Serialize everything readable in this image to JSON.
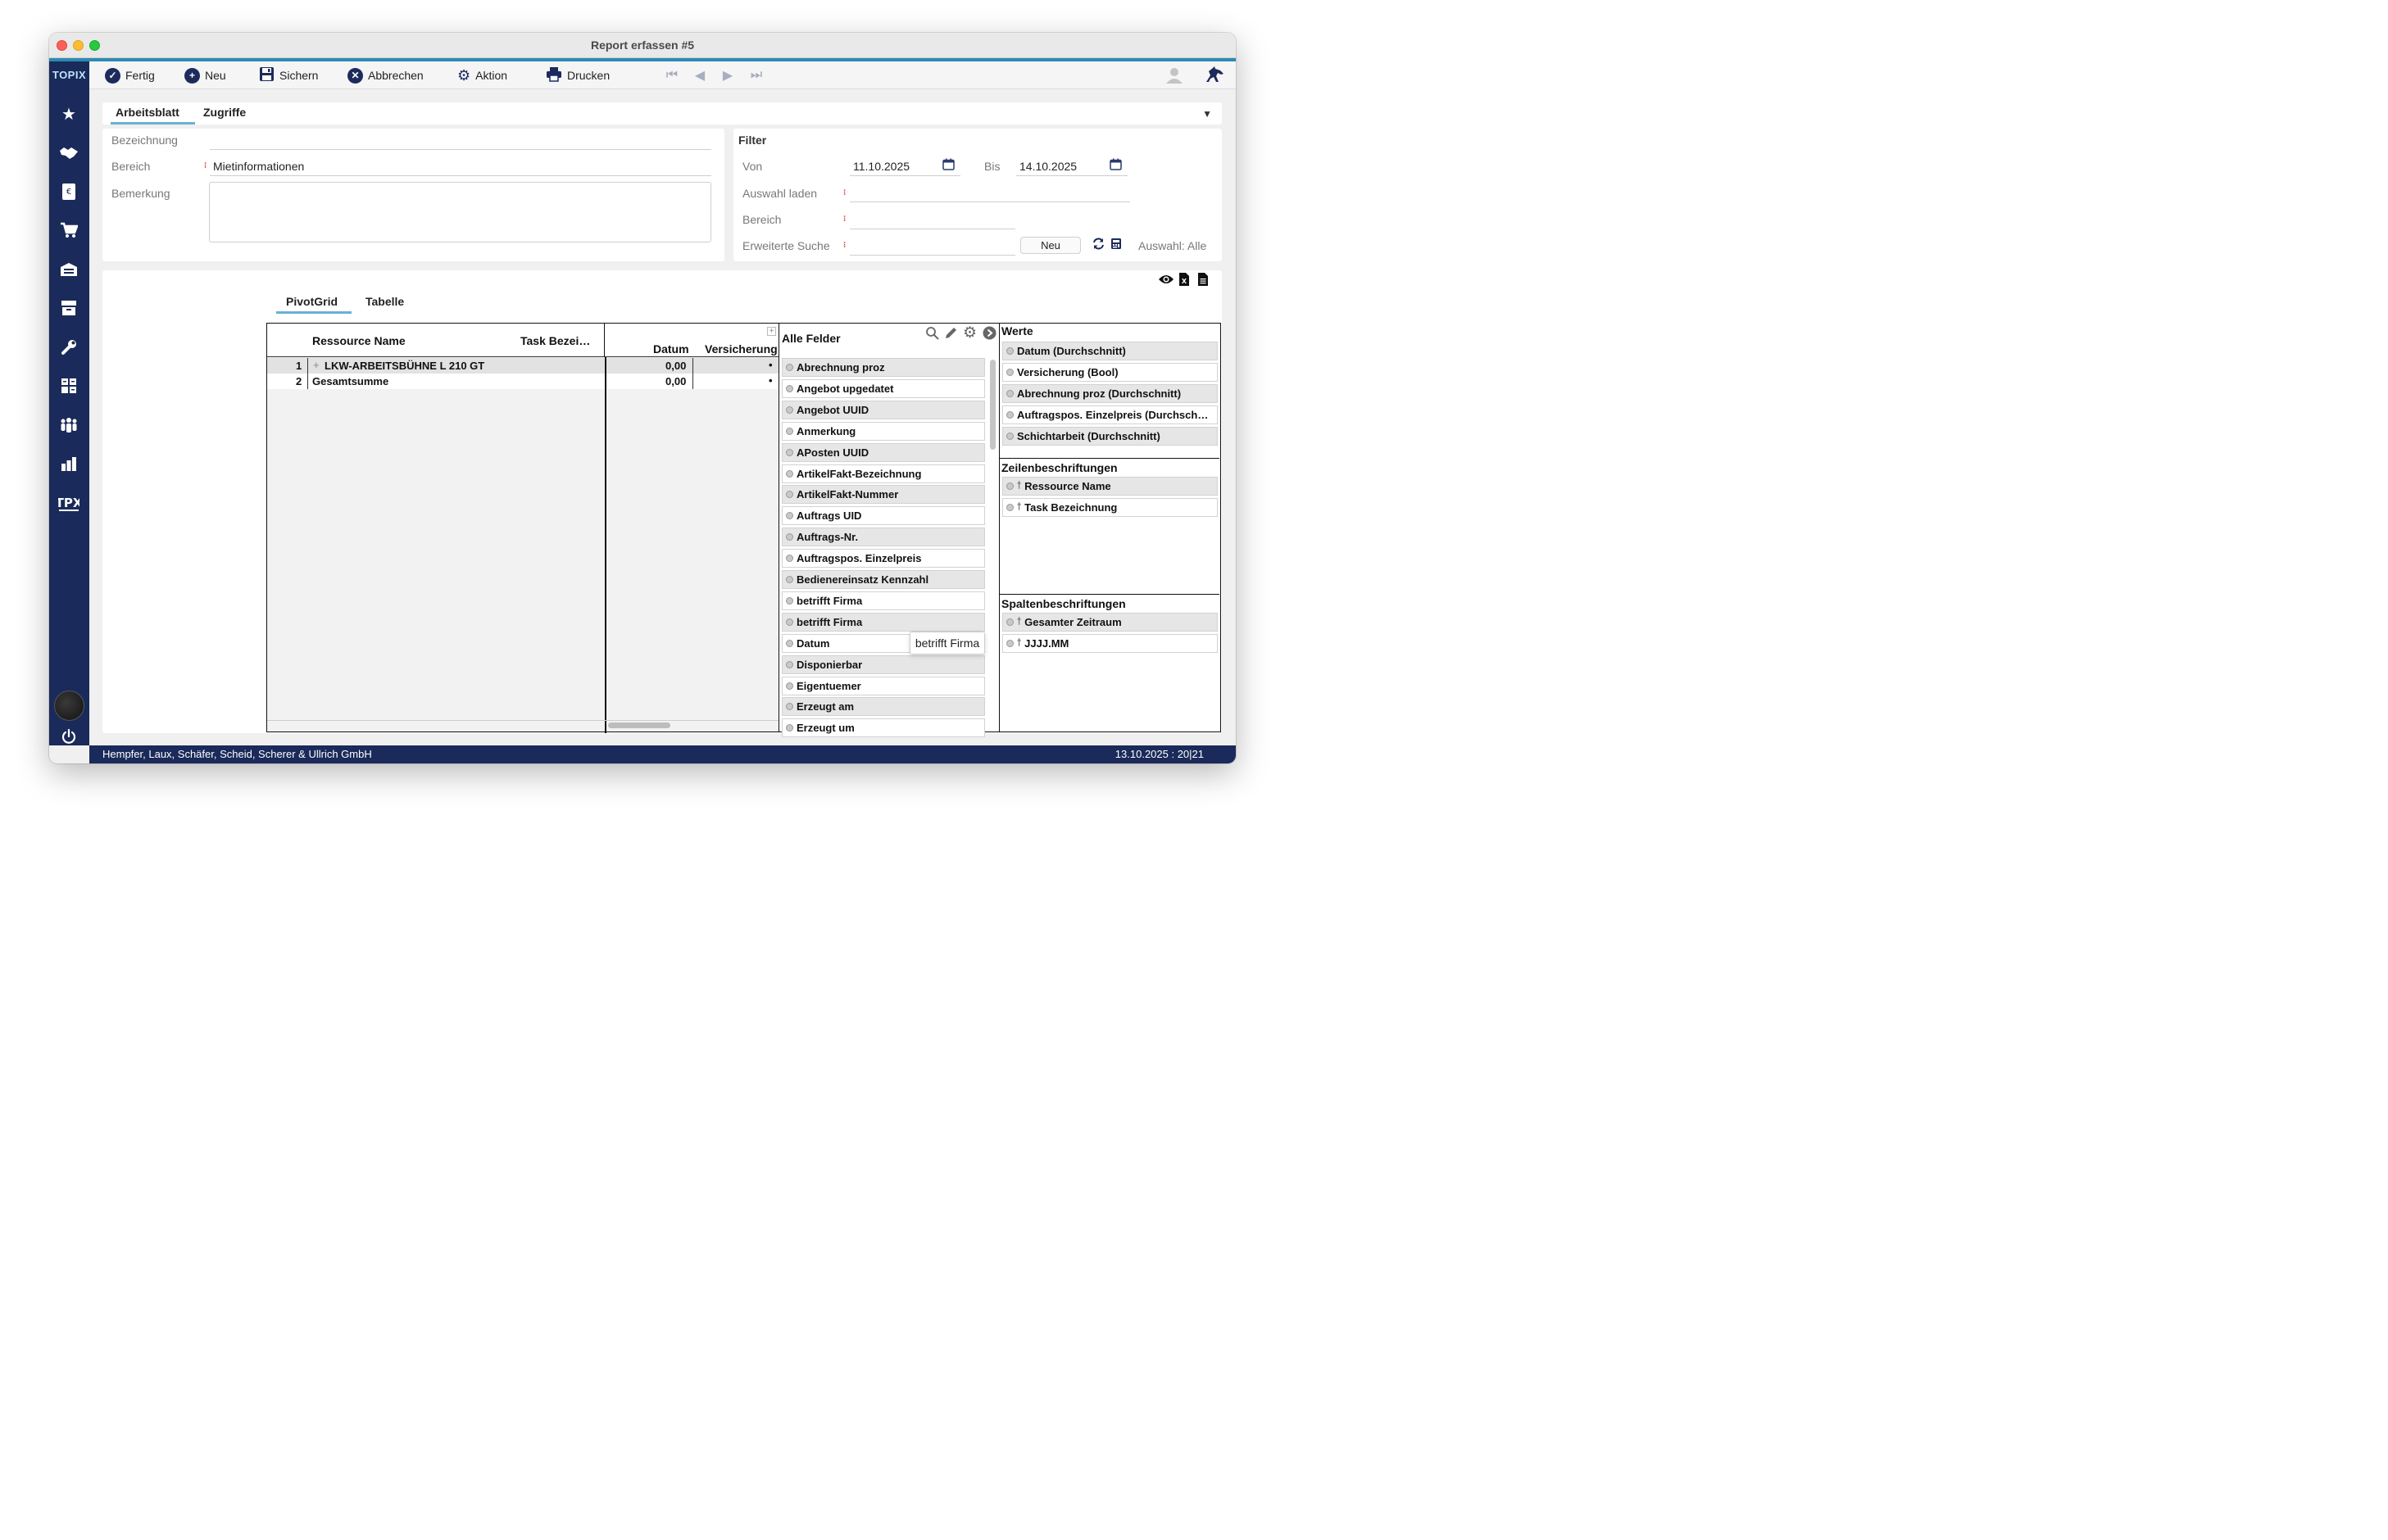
{
  "window": {
    "title": "Report erfassen #5"
  },
  "sidebar": {
    "logo": "TOPIX",
    "icons": [
      "star-icon",
      "handshake-icon",
      "invoice-icon",
      "cart-icon",
      "warehouse-icon",
      "archive-icon",
      "wrench-icon",
      "calculator-icon",
      "people-icon",
      "bar-chart-icon",
      "tpx-icon"
    ],
    "bottom_icon": "power-icon"
  },
  "toolbar": {
    "fertig": "Fertig",
    "neu": "Neu",
    "sichern": "Sichern",
    "abbrechen": "Abbrechen",
    "aktion": "Aktion",
    "drucken": "Drucken"
  },
  "tabs": {
    "arbeitsblatt": "Arbeitsblatt",
    "zugriffe": "Zugriffe"
  },
  "form": {
    "bezeichnung_label": "Bezeichnung",
    "bezeichnung_value": "",
    "bereich_label": "Bereich",
    "bereich_value": "Mietinformationen",
    "bemerkung_label": "Bemerkung",
    "bemerkung_value": ""
  },
  "filter": {
    "title": "Filter",
    "von_label": "Von",
    "von_value": "11.10.2025",
    "bis_label": "Bis",
    "bis_value": "14.10.2025",
    "auswahl_laden_label": "Auswahl laden",
    "bereich_label": "Bereich",
    "erweiterte_suche_label": "Erweiterte Suche",
    "neu_button": "Neu",
    "auswahl_text": "Auswahl: Alle"
  },
  "pivot_tabs": {
    "pivotgrid": "PivotGrid",
    "tabelle": "Tabelle"
  },
  "grid": {
    "col_ressource": "Ressource Name",
    "col_task": "Task Bezei…",
    "col_datum": "Datum",
    "col_versicherung": "Versicherung",
    "rows": [
      {
        "num": "1",
        "expand": "+",
        "name": "LKW-ARBEITSBÜHNE L 210 GT",
        "datum": "0,00",
        "versicherung": "•"
      },
      {
        "num": "2",
        "expand": "",
        "name": "Gesamtsumme",
        "datum": "0,00",
        "versicherung": "•"
      }
    ]
  },
  "fields": {
    "title": "Alle Felder",
    "items": [
      "Abrechnung proz",
      "Angebot upgedatet",
      "Angebot UUID",
      "Anmerkung",
      "APosten UUID",
      "ArtikelFakt-Bezeichnung",
      "ArtikelFakt-Nummer",
      "Auftrags UID",
      "Auftrags-Nr.",
      "Auftragspos. Einzelpreis",
      "Bedienereinsatz Kennzahl",
      "betrifft Firma",
      "betrifft Firma",
      "Datum",
      "Disponierbar",
      "Eigentuemer",
      "Erzeugt am",
      "Erzeugt um"
    ],
    "tooltip": "betrifft Firma"
  },
  "areas": {
    "werte_title": "Werte",
    "werte": [
      "Datum (Durchschnitt)",
      "Versicherung (Bool)",
      "Abrechnung proz (Durchschnitt)",
      "Auftragspos. Einzelpreis (Durchsch…",
      "Schichtarbeit (Durchschnitt)"
    ],
    "zeilen_title": "Zeilenbeschriftungen",
    "zeilen": [
      "Ressource Name",
      "Task Bezeichnung"
    ],
    "spalten_title": "Spaltenbeschriftungen",
    "spalten": [
      "Gesamter Zeitraum",
      "JJJJ.MM"
    ]
  },
  "status": {
    "company": "Hempfer, Laux, Schäfer, Scheid, Scherer & Ullrich GmbH",
    "datetime": "13.10.2025 : 20|21"
  },
  "colors": {
    "sidebar": "#1a2a5a",
    "accent": "#2b8ab3",
    "required": "#e04545"
  }
}
